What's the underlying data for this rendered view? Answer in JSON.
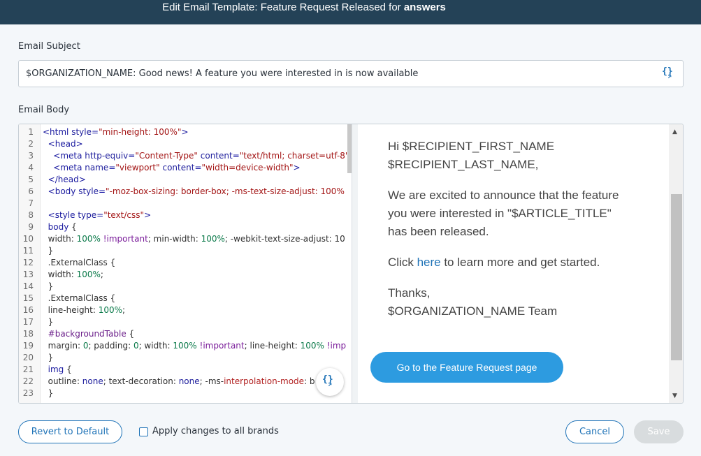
{
  "header": {
    "title_prefix": "Edit Email Template: Feature Request Released for ",
    "title_brand": "answers"
  },
  "subject": {
    "label": "Email Subject",
    "value": "$ORGANIZATION_NAME: Good news! A feature you were interested in is now available"
  },
  "body": {
    "label": "Email Body",
    "code_lines": [
      {
        "n": "1"
      },
      {
        "n": "2"
      },
      {
        "n": "3"
      },
      {
        "n": "4"
      },
      {
        "n": "5"
      },
      {
        "n": "6"
      },
      {
        "n": "7"
      },
      {
        "n": "8"
      },
      {
        "n": "9"
      },
      {
        "n": "10"
      },
      {
        "n": "11"
      },
      {
        "n": "12"
      },
      {
        "n": "13"
      },
      {
        "n": "14"
      },
      {
        "n": "15"
      },
      {
        "n": "16"
      },
      {
        "n": "17"
      },
      {
        "n": "18"
      },
      {
        "n": "19"
      },
      {
        "n": "20"
      },
      {
        "n": "21"
      },
      {
        "n": "22"
      },
      {
        "n": "23"
      }
    ]
  },
  "preview": {
    "greeting_line1": "Hi $RECIPIENT_FIRST_NAME",
    "greeting_line2": "$RECIPIENT_LAST_NAME,",
    "intro_line1": "We are excited to announce that the feature",
    "intro_line2": "you were interested in \"$ARTICLE_TITLE\"",
    "intro_line3": "has been released.",
    "click_prefix": "Click ",
    "click_link": "here",
    "click_suffix": " to learn more and get started.",
    "thanks": "Thanks,",
    "signature": "$ORGANIZATION_NAME Team",
    "cta_label": "Go to the Feature Request page"
  },
  "footer": {
    "revert_label": "Revert to Default",
    "apply_all_label": "Apply changes to all brands",
    "cancel_label": "Cancel",
    "save_label": "Save"
  },
  "colors": {
    "header_bg": "#244257",
    "accent": "#1f73b7",
    "cta": "#2d9be0"
  },
  "icons": {
    "placeholder_picker": "placeholder-icon"
  }
}
